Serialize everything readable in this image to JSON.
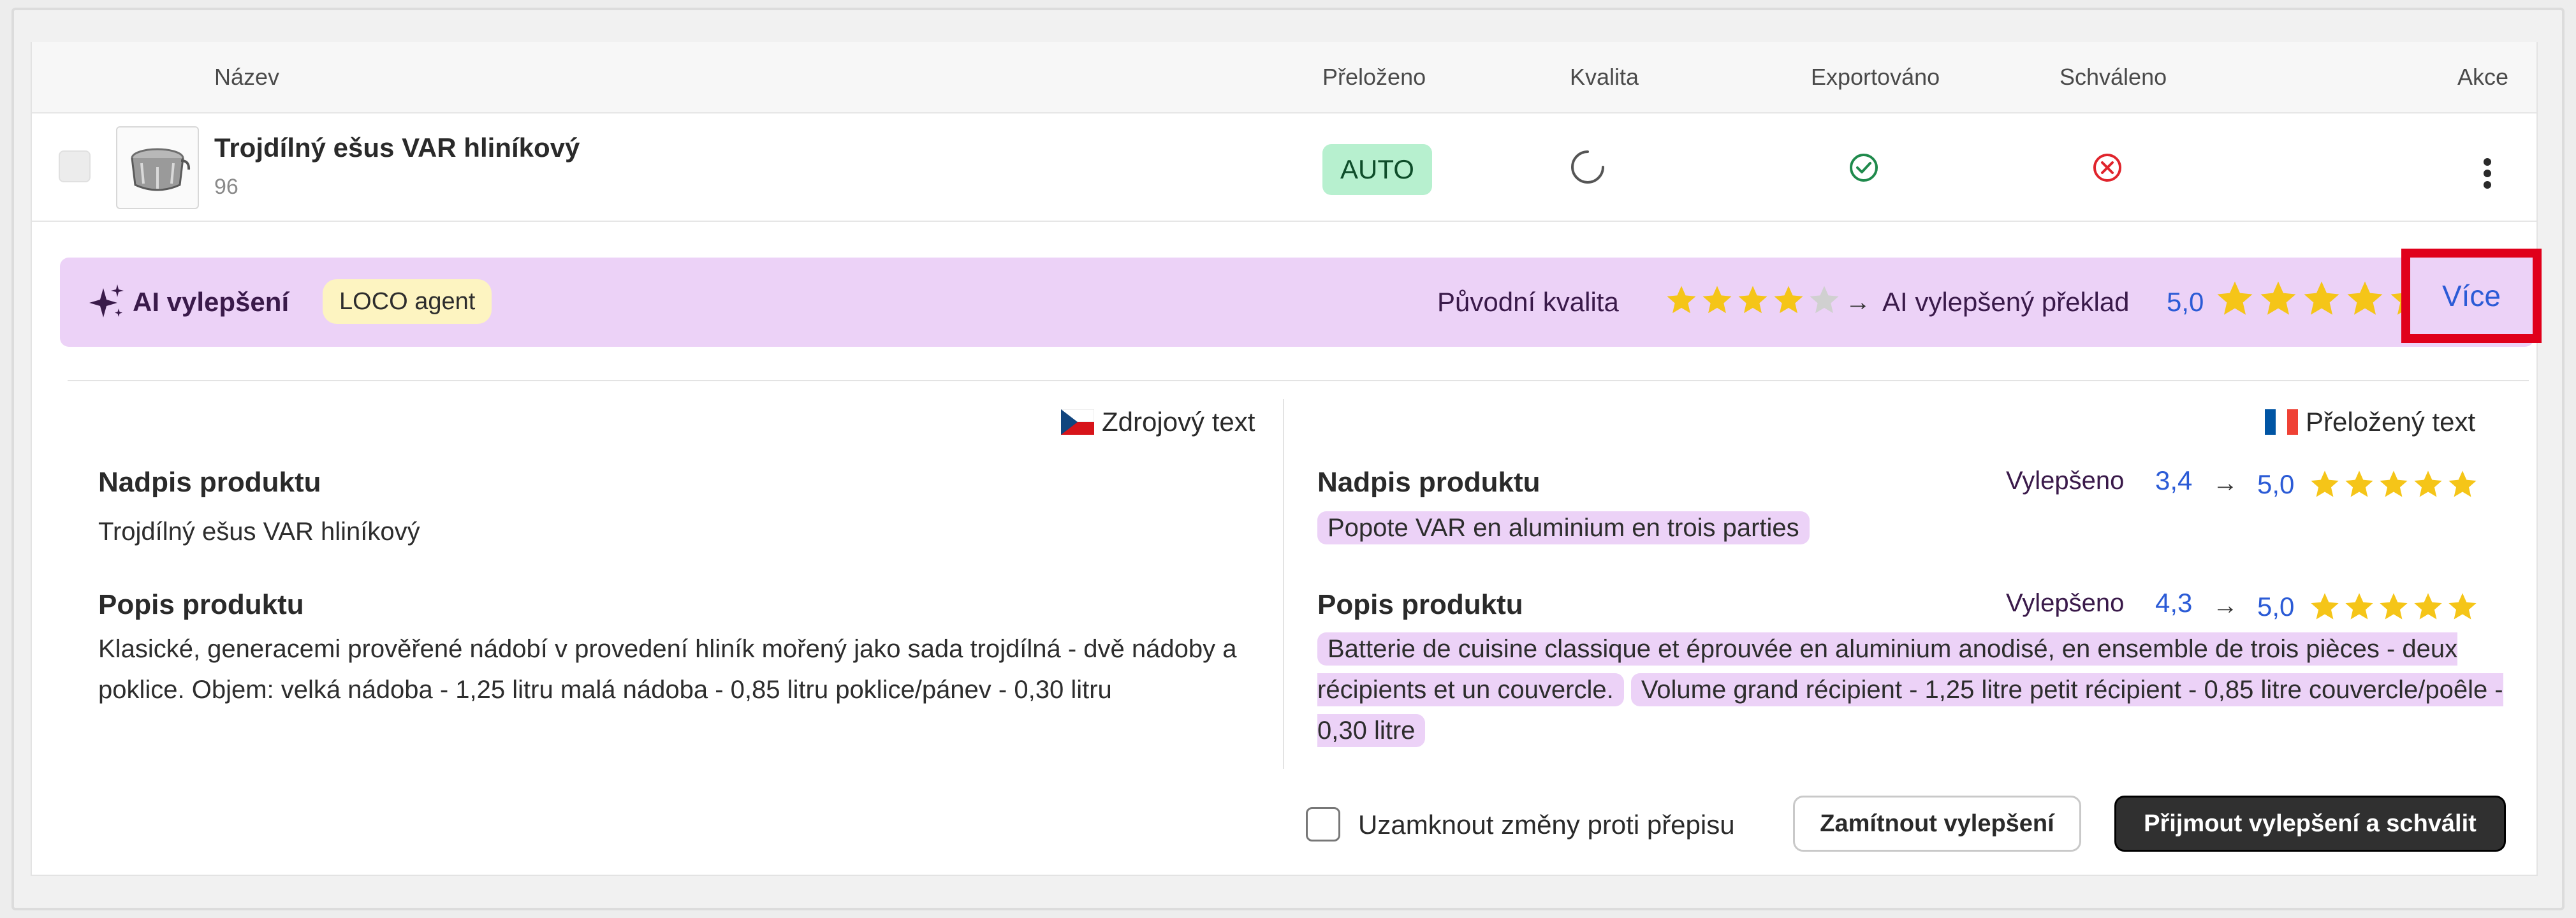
{
  "table": {
    "columns": {
      "name": "Název",
      "translated": "Přeloženo",
      "quality": "Kvalita",
      "exported": "Exportováno",
      "approved": "Schváleno",
      "actions": "Akce"
    },
    "row": {
      "product_name": "Trojdílný ešus VAR hliníkový",
      "product_id": "96",
      "translated_badge": "AUTO",
      "quality_icon": "loading-spinner-icon",
      "exported_icon": "check-circle-icon",
      "approved_icon": "x-circle-icon",
      "actions_icon": "kebab-menu-icon"
    }
  },
  "ai_banner": {
    "title": "AI vylepšení",
    "agent_badge": "LOCO agent",
    "original_quality_label": "Původní kvalita",
    "original_quality_stars": 4,
    "arrow": "→",
    "ai_label": "AI vylepšený překlad",
    "ai_score": "5,0",
    "ai_stars": 5,
    "more_link": "Více"
  },
  "source": {
    "header": "Zdrojový text",
    "flag": "cz-flag-icon",
    "title_section": "Nadpis produktu",
    "title_text": "Trojdílný ešus VAR hliníkový",
    "description_section": "Popis produktu",
    "description_text": "Klasické, generacemi prověřené nádobí v provedení hliník mořený jako sada trojdílná - dvě nádoby a poklice. Objem: velká nádoba - 1,25 litru malá nádoba - 0,85 litru poklice/pánev - 0,30 litru"
  },
  "translated": {
    "header": "Přeložený text",
    "flag": "fr-flag-icon",
    "title_section": "Nadpis produktu",
    "title_improved_label": "Vylepšeno",
    "title_score_before": "3,4",
    "title_score_after": "5,0",
    "title_stars": 5,
    "title_text": "Popote VAR en aluminium en trois parties",
    "description_section": "Popis produktu",
    "description_improved_label": "Vylepšeno",
    "description_score_before": "4,3",
    "description_score_after": "5,0",
    "description_stars": 5,
    "description_part1": "Batterie de cuisine classique et éprouvée en aluminium anodisé, en ensemble de trois pièces - deux récipients et un couvercle.",
    "description_part2": "Volume grand récipient - 1,25 litre petit récipient - 0,85 litre couvercle/poêle - 0,30 litre"
  },
  "footer": {
    "lock_label": "Uzamknout změny proti přepisu",
    "lock_checked": false,
    "reject_button": "Zamítnout vylepšení",
    "accept_button": "Přijmout vylepšení a schválit"
  },
  "colors": {
    "banner_bg": "#ecd2f7",
    "badge_auto_bg": "#b7f0cf",
    "loco_bg": "#fdf4c1",
    "star": "#f5c518",
    "star_empty": "#d0d0d0",
    "score_blue": "#2b5bd6",
    "highlight": "#e0001b",
    "check_green": "#1f8a4c",
    "x_red": "#e0242c"
  }
}
